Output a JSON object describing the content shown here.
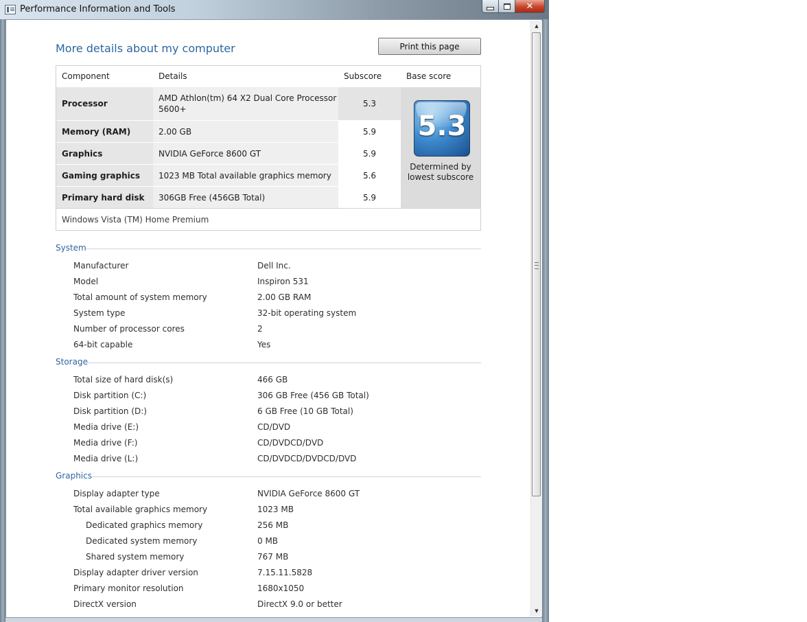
{
  "window": {
    "title": "Performance Information and Tools",
    "close_glyph": "✕"
  },
  "page": {
    "heading": "More details about my computer",
    "print_button": "Print this page"
  },
  "score_table": {
    "headers": {
      "component": "Component",
      "details": "Details",
      "subscore": "Subscore",
      "base_score": "Base score"
    },
    "rows": [
      {
        "component": "Processor",
        "details": "AMD Athlon(tm) 64 X2 Dual Core Processor 5600+",
        "subscore": "5.3"
      },
      {
        "component": "Memory (RAM)",
        "details": "2.00 GB",
        "subscore": "5.9"
      },
      {
        "component": "Graphics",
        "details": "NVIDIA GeForce 8600 GT",
        "subscore": "5.9"
      },
      {
        "component": "Gaming graphics",
        "details": "1023 MB Total available graphics memory",
        "subscore": "5.6"
      },
      {
        "component": "Primary hard disk",
        "details": "306GB Free (456GB Total)",
        "subscore": "5.9"
      }
    ],
    "base_score": "5.3",
    "base_caption": "Determined by lowest subscore",
    "edition": "Windows Vista (TM) Home Premium"
  },
  "sections": {
    "system": {
      "title": "System",
      "items": [
        {
          "label": "Manufacturer",
          "value": "Dell Inc."
        },
        {
          "label": "Model",
          "value": "Inspiron 531"
        },
        {
          "label": "Total amount of system memory",
          "value": "2.00 GB RAM"
        },
        {
          "label": "System type",
          "value": "32-bit operating system"
        },
        {
          "label": "Number of processor cores",
          "value": "2"
        },
        {
          "label": "64-bit capable",
          "value": "Yes"
        }
      ]
    },
    "storage": {
      "title": "Storage",
      "items": [
        {
          "label": "Total size of hard disk(s)",
          "value": "466 GB"
        },
        {
          "label": "Disk partition (C:)",
          "value": "306 GB Free (456 GB Total)"
        },
        {
          "label": "Disk partition (D:)",
          "value": "6 GB Free (10 GB Total)"
        },
        {
          "label": "Media drive (E:)",
          "value": "CD/DVD"
        },
        {
          "label": "Media drive (F:)",
          "value": "CD/DVDCD/DVD"
        },
        {
          "label": "Media drive (L:)",
          "value": "CD/DVDCD/DVDCD/DVD"
        }
      ]
    },
    "graphics": {
      "title": "Graphics",
      "items": [
        {
          "label": "Display adapter type",
          "value": "NVIDIA GeForce 8600 GT"
        },
        {
          "label": "Total available graphics memory",
          "value": "1023 MB"
        },
        {
          "label": "Dedicated graphics memory",
          "value": "256 MB"
        },
        {
          "label": "Dedicated system memory",
          "value": "0 MB"
        },
        {
          "label": "Shared system memory",
          "value": "767 MB"
        },
        {
          "label": "Display adapter driver version",
          "value": "7.15.11.5828"
        },
        {
          "label": "Primary monitor resolution",
          "value": "1680x1050"
        },
        {
          "label": "DirectX version",
          "value": "DirectX 9.0 or better"
        }
      ]
    }
  }
}
